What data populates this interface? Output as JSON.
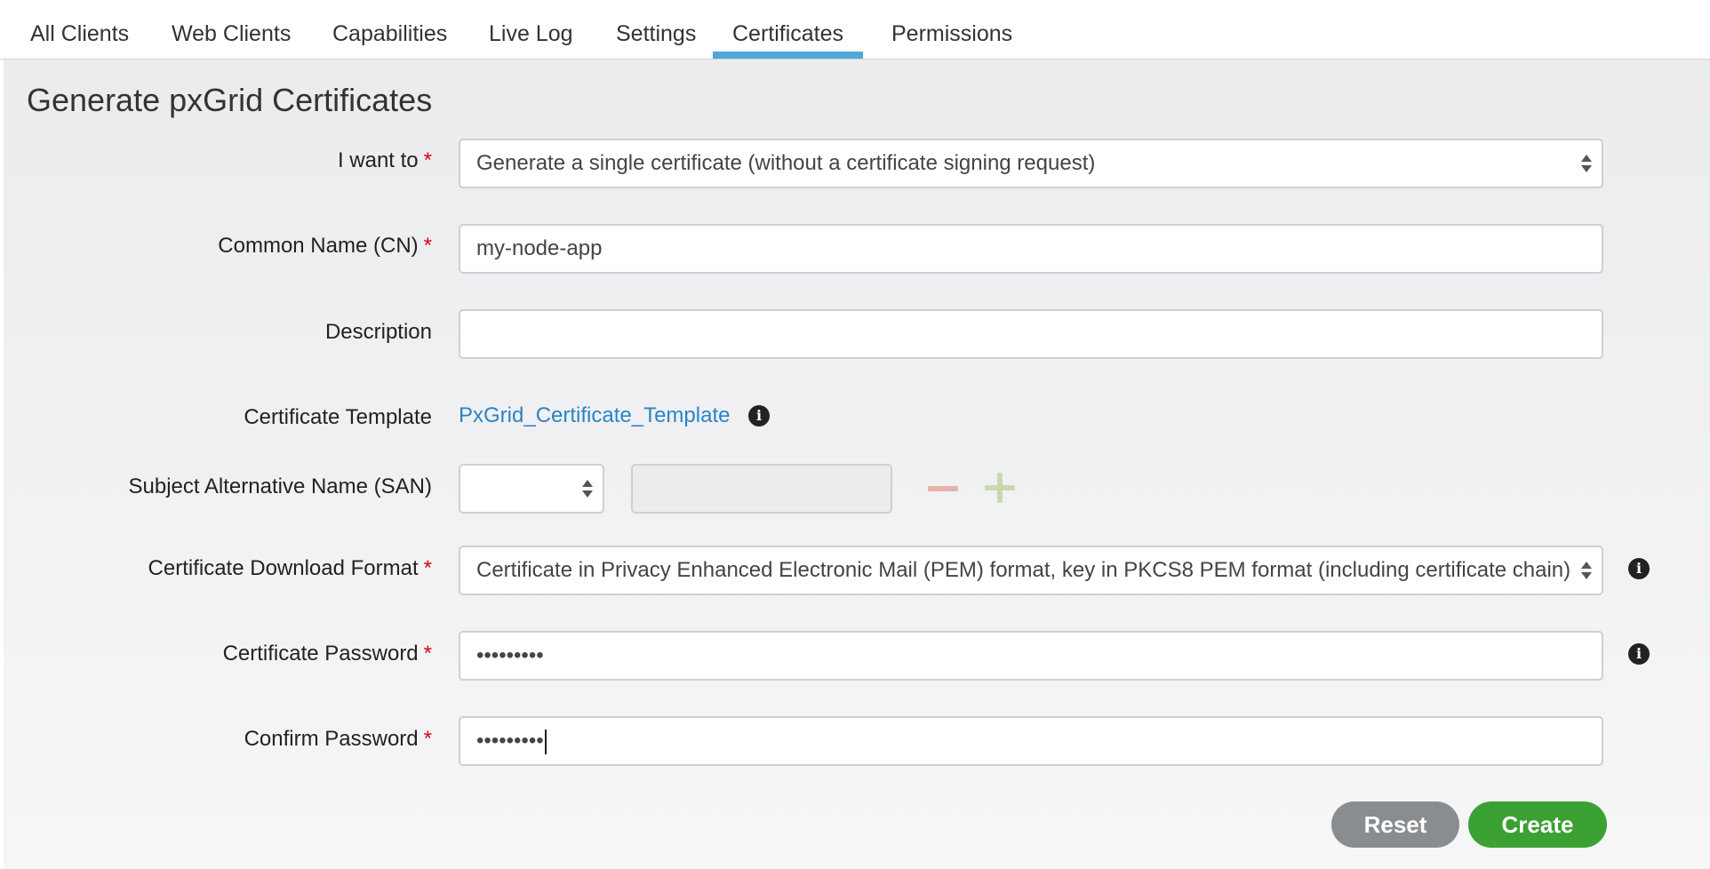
{
  "tabs": [
    {
      "label": "All Clients",
      "active": false
    },
    {
      "label": "Web Clients",
      "active": false
    },
    {
      "label": "Capabilities",
      "active": false
    },
    {
      "label": "Live Log",
      "active": false
    },
    {
      "label": "Settings",
      "active": false
    },
    {
      "label": "Certificates",
      "active": true
    },
    {
      "label": "Permissions",
      "active": false
    }
  ],
  "page": {
    "title": "Generate pxGrid Certificates"
  },
  "form": {
    "i_want_to": {
      "label": "I want to",
      "required": "*",
      "value": "Generate a single certificate (without a certificate signing request)"
    },
    "common_name": {
      "label": "Common Name (CN)",
      "required": "*",
      "value": "my-node-app"
    },
    "description": {
      "label": "Description",
      "value": ""
    },
    "certificate_template": {
      "label": "Certificate Template",
      "value": "PxGrid_Certificate_Template",
      "info_icon": "info-icon"
    },
    "san": {
      "label": "Subject Alternative Name (SAN)",
      "type_value": "",
      "value": ""
    },
    "download_format": {
      "label": "Certificate Download Format",
      "required": "*",
      "value": "Certificate in Privacy Enhanced Electronic Mail (PEM) format, key in PKCS8 PEM format (including certificate chain)",
      "info_icon": "info-icon"
    },
    "password": {
      "label": "Certificate Password",
      "required": "*",
      "value": "•••••••••",
      "info_icon": "info-icon"
    },
    "confirm_password": {
      "label": "Confirm Password",
      "required": "*",
      "value": "•••••••••"
    }
  },
  "buttons": {
    "reset": "Reset",
    "create": "Create"
  },
  "colors": {
    "accent": "#4fa8d8",
    "link": "#2a84c6",
    "required": "#d0021b",
    "create": "#3aa132",
    "reset": "#8a8d90"
  }
}
